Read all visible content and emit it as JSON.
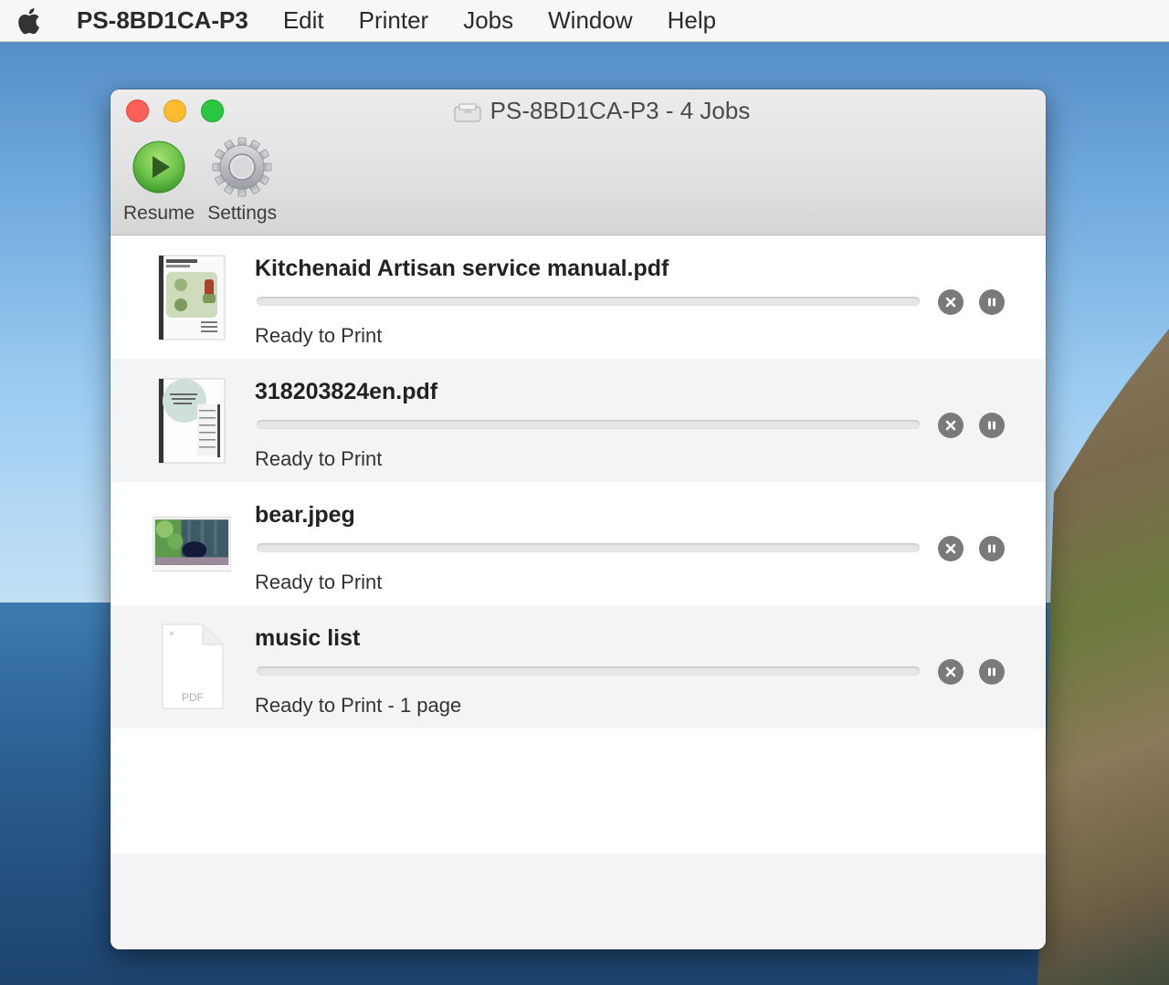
{
  "menubar": {
    "apple_icon": "apple-logo-icon",
    "app_name": "PS-8BD1CA-P3",
    "items": [
      "Edit",
      "Printer",
      "Jobs",
      "Window",
      "Help"
    ]
  },
  "window": {
    "title": "PS-8BD1CA-P3 - 4 Jobs",
    "title_icon": "printer-icon",
    "toolbar": {
      "resume_label": "Resume",
      "settings_label": "Settings"
    }
  },
  "jobs": [
    {
      "name": "Kitchenaid Artisan service manual.pdf",
      "status": "Ready to Print",
      "progress": 0,
      "thumbnail": "manual-document-thumbnail"
    },
    {
      "name": "318203824en.pdf",
      "status": "Ready to Print",
      "progress": 0,
      "thumbnail": "manual-document-thumbnail"
    },
    {
      "name": "bear.jpeg",
      "status": "Ready to Print",
      "progress": 0,
      "thumbnail": "bear-photo-thumbnail"
    },
    {
      "name": "music list",
      "status": "Ready to Print - 1 page",
      "progress": 0,
      "thumbnail": "pdf-file-icon",
      "thumbnail_label": "PDF"
    }
  ],
  "colors": {
    "close": "#fc5f57",
    "minimize": "#fdbc2e",
    "maximize": "#29c840",
    "resume_green": "#6cc24a",
    "job_button": "#7a7a7a"
  }
}
